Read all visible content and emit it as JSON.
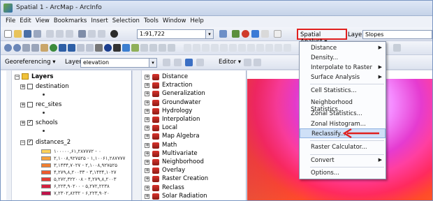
{
  "window": {
    "title": "Spatial 1 - ArcMap - ArcInfo"
  },
  "menu": [
    "File",
    "Edit",
    "View",
    "Bookmarks",
    "Insert",
    "Selection",
    "Tools",
    "Window",
    "Help"
  ],
  "toolbar1": {
    "scale": "1:91,722",
    "spatial_analyst_label": "Spatial Analyst ▾",
    "layer_label": "Layer:",
    "layer_value": "Slopes"
  },
  "toolbar3": {
    "georef_label": "Georeferencing ▾",
    "layer_label": "Layer:",
    "layer_value": "elevation",
    "editor_label": "Editor ▾"
  },
  "toc": {
    "root": "Layers",
    "layers": [
      {
        "name": "destination",
        "checked": false
      },
      {
        "name": "rec_sites",
        "checked": false
      },
      {
        "name": "schools",
        "checked": true
      },
      {
        "name": "distances_2",
        "checked": true
      }
    ],
    "legend": [
      {
        "label": "۱۰۰۰۰۰,۶۱,۲۸۷۷۷۲ - ۰",
        "color": "#ffd25a"
      },
      {
        "label": "۲,۱۰۰۸,۹۲۷۵۲۵ - ۱,۱۰۰۶۱,۲۸۷۷۷۷",
        "color": "#f9a13a"
      },
      {
        "label": "۳,۱۴۳۴,۷۰۲۷ - ۲,۱۰۰۸,۹۲۷۵۲۵",
        "color": "#f27e30"
      },
      {
        "label": "۴,۲۷۹,۸,۲۰۰۳۳ - ۳,۱۴۳۴,۱۰۲۷",
        "color": "#ef5a2c"
      },
      {
        "label": "۵,۲۷۲,۳۲۲۰۰۸ - ۴,۲۷۹,۸,۲۰۰۳",
        "color": "#e63a33"
      },
      {
        "label": "۶,۲۲۳,۹۰۲۰۰ - ۵,۲۷۲,۲۲۳۸",
        "color": "#d81e3d"
      },
      {
        "label": "۷,۲۳۰۲,۸۲۳۲ - ۶,۲۲۳,۹۰۲۰",
        "color": "#c1124a"
      }
    ]
  },
  "toolbox": {
    "items": [
      "Distance",
      "Extraction",
      "Generalization",
      "Groundwater",
      "Hydrology",
      "Interpolation",
      "Local",
      "Map Algebra",
      "Math",
      "Multivariate",
      "Neighborhood",
      "Overlay",
      "Raster Creation",
      "Reclass",
      "Solar Radiation"
    ]
  },
  "dropdown": {
    "items": [
      {
        "label": "Distance",
        "has_sub": true
      },
      {
        "label": "Density...",
        "has_sub": false
      },
      {
        "label": "Interpolate to Raster",
        "has_sub": true
      },
      {
        "label": "Surface Analysis",
        "has_sub": true
      },
      {
        "label": "Cell Statistics...",
        "has_sub": false
      },
      {
        "label": "Neighborhood Statistics...",
        "has_sub": false
      },
      {
        "label": "Zonal Statistics...",
        "has_sub": false
      },
      {
        "label": "Zonal Histogram...",
        "has_sub": false
      },
      {
        "label": "Reclassify...",
        "has_sub": false
      },
      {
        "label": "Raster Calculator...",
        "has_sub": false
      },
      {
        "label": "Convert",
        "has_sub": true
      },
      {
        "label": "Options...",
        "has_sub": false
      }
    ]
  },
  "colors": {
    "highlight_box": "#e0201f",
    "arrow": "#e0201f"
  }
}
